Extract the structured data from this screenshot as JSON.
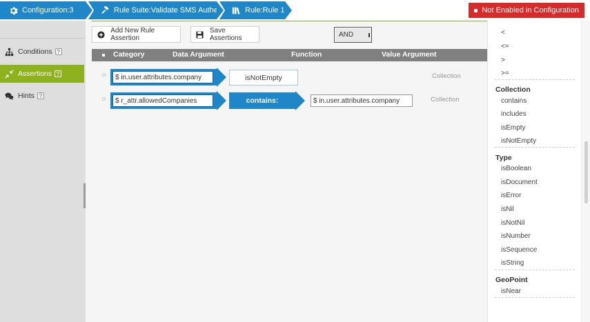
{
  "breadcrumb": {
    "items": [
      {
        "label": "Configuration:3",
        "icon": "gear-icon"
      },
      {
        "label": "Rule Suite:Validate SMS Authentication",
        "icon": "gavel-icon"
      },
      {
        "label": "Rule:Rule 1",
        "icon": "books-icon"
      }
    ]
  },
  "status": {
    "label": "Not Enabled in Configuration",
    "color": "#d62b2b"
  },
  "sidebar": {
    "items": [
      {
        "label": "Conditions",
        "icon": "hierarchy-icon",
        "help": "?"
      },
      {
        "label": "Assertions",
        "icon": "collapse-arrows-icon",
        "help": "?",
        "active": true
      },
      {
        "label": "Hints",
        "icon": "chat-bubbles-icon",
        "help": "?"
      }
    ],
    "accent": "#8eb21d"
  },
  "toolbar": {
    "add_label": "Add New Rule Assertion",
    "save_label": "Save Assertions",
    "logic_value": "AND"
  },
  "table": {
    "headers": {
      "category": "Category",
      "data_argument": "Data Argument",
      "function": "Function",
      "value_argument": "Value Argument"
    },
    "rows": [
      {
        "data_argument": "$ in.user.attributes.company",
        "function": "isNotEmpty",
        "value_argument": "",
        "category": "Collection"
      },
      {
        "data_argument": "$ r_attr.allowedCompanies",
        "function": "contains:",
        "value_argument": "$ in.user.attributes.company",
        "category": "Collection"
      }
    ]
  },
  "functions_panel": {
    "top_items": [
      "<",
      "<=",
      ">",
      ">="
    ],
    "groups": [
      {
        "title": "Collection",
        "items": [
          "contains",
          "includes",
          "isEmpty",
          "isNotEmpty"
        ]
      },
      {
        "title": "Type",
        "items": [
          "isBoolean",
          "isDocument",
          "isError",
          "isNil",
          "isNotNil",
          "isNumber",
          "isSequence",
          "isString"
        ]
      },
      {
        "title": "GeoPoint",
        "items": [
          "isNear"
        ]
      }
    ]
  },
  "colors": {
    "primary": "#1f86c8",
    "header_bg": "#808080"
  }
}
